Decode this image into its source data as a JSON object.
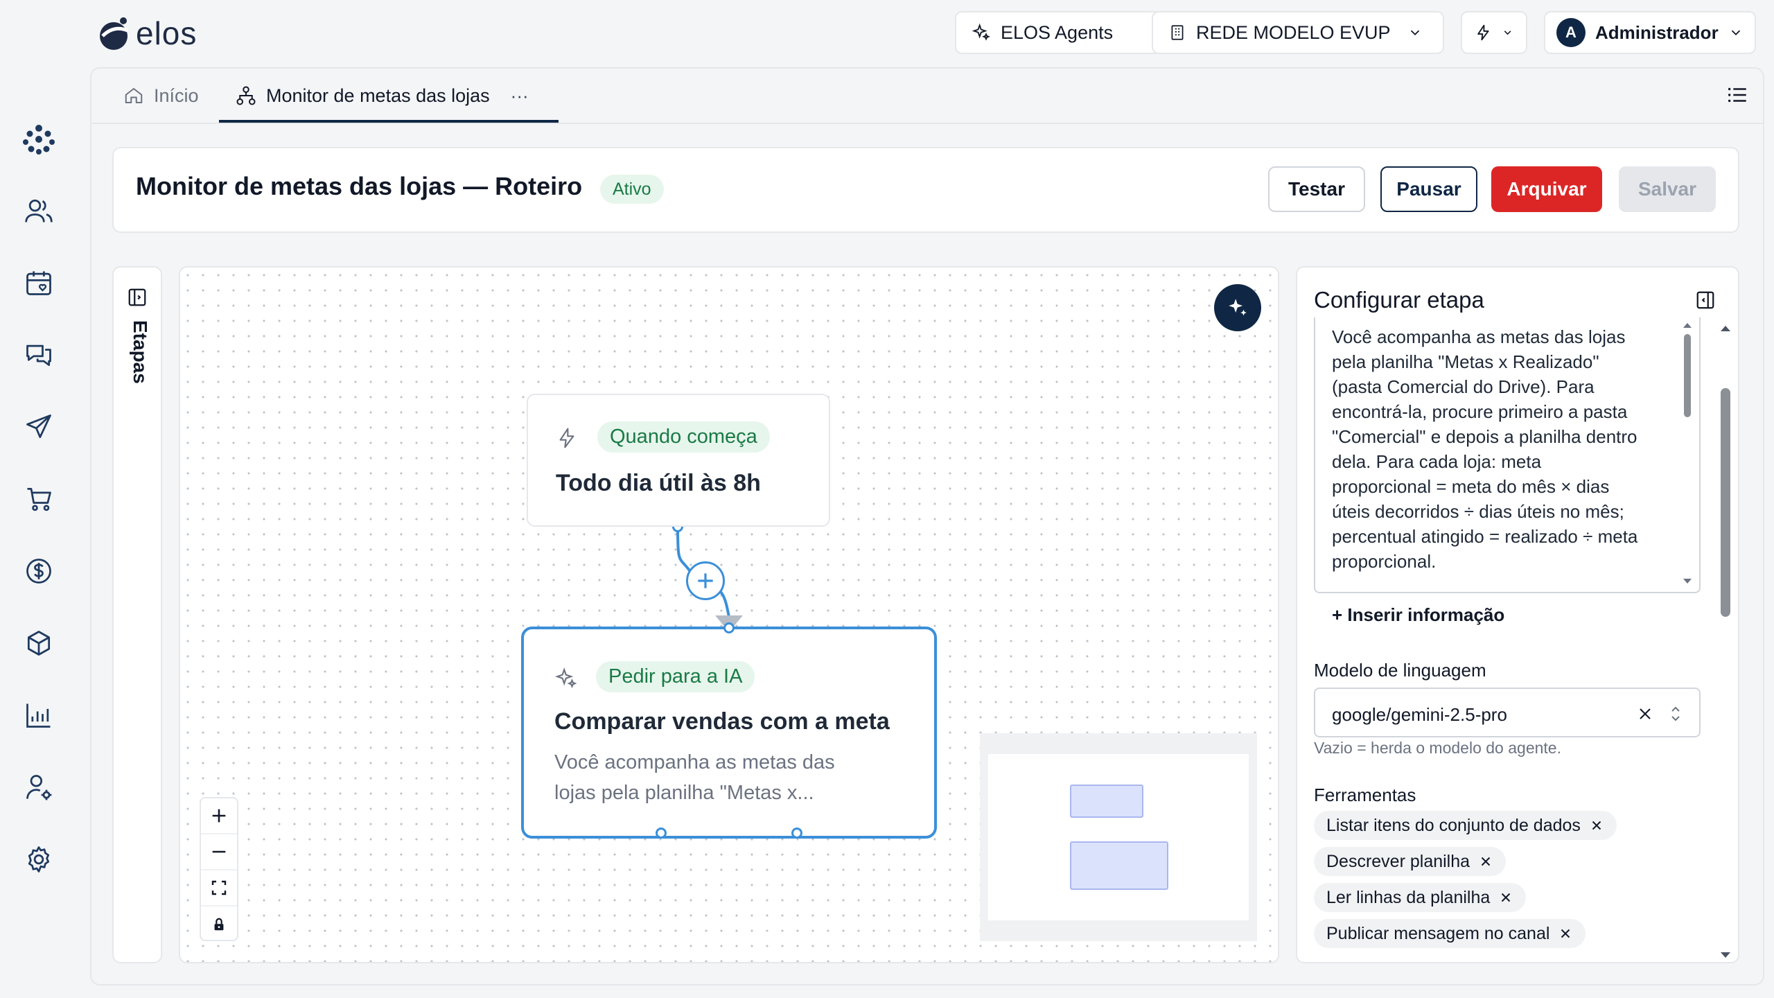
{
  "brand": {
    "logo_text": "elos"
  },
  "topbar": {
    "agents_label": "ELOS Agents",
    "network_label": "REDE MODELO EVUP",
    "user_initial": "A",
    "user_name": "Administrador"
  },
  "tabs": [
    {
      "label": "Início"
    },
    {
      "label": "Monitor de metas das lojas"
    }
  ],
  "tabs_more": "···",
  "header": {
    "title": "Monitor de metas das lojas — Roteiro",
    "status": "Ativo",
    "buttons": {
      "test": "Testar",
      "pause": "Pausar",
      "archive": "Arquivar",
      "save": "Salvar"
    }
  },
  "steps_rail": {
    "label": "Etapas"
  },
  "canvas": {
    "trigger_node": {
      "badge": "Quando começa",
      "title": "Todo dia útil às 8h"
    },
    "ai_node": {
      "badge": "Pedir para a IA",
      "title": "Comparar vendas com a meta",
      "preview_line1": "Você acompanha as metas das",
      "preview_line2": "lojas pela planilha \"Metas x..."
    },
    "zoom_controls": [
      "zoom-in",
      "zoom-out",
      "fit-view",
      "lock"
    ]
  },
  "config": {
    "title": "Configurar etapa",
    "prompt_lines": [
      "Você acompanha as metas das lojas",
      "pela planilha \"Metas x Realizado\"",
      "(pasta Comercial do Drive). Para",
      "encontrá-la, procure primeiro a pasta",
      "\"Comercial\" e depois a planilha dentro",
      "dela. Para cada loja: meta",
      "proporcional = meta do mês × dias",
      "úteis decorridos ÷ dias úteis no mês;",
      "percentual atingido = realizado ÷ meta",
      "proporcional."
    ],
    "insert_info": "+ Inserir informação",
    "model_label": "Modelo de linguagem",
    "model_value": "google/gemini-2.5-pro",
    "model_hint": "Vazio = herda o modelo do agente.",
    "tools_label": "Ferramentas",
    "tools": [
      "Listar itens do conjunto de dados",
      "Descrever planilha",
      "Ler linhas da planilha",
      "Publicar mensagem no canal"
    ]
  },
  "colors": {
    "primary": "#0f2744",
    "danger": "#dc2626",
    "accent": "#3b8fd9",
    "success": "#1a7a46"
  }
}
